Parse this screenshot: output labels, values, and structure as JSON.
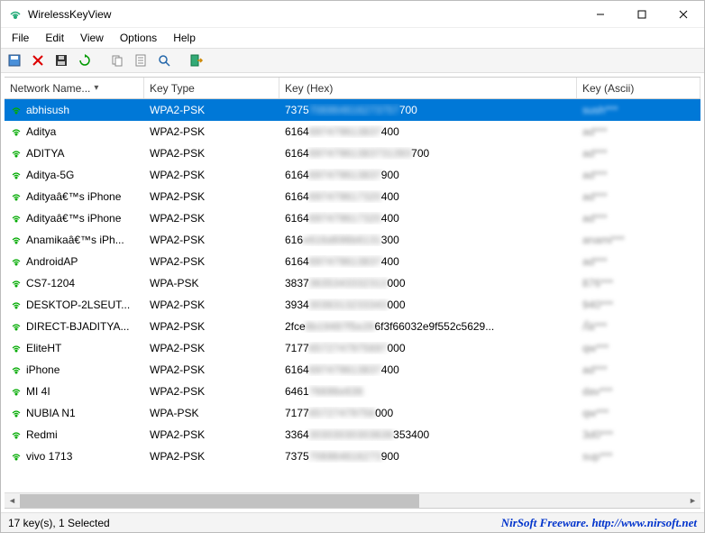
{
  "window": {
    "title": "WirelessKeyView"
  },
  "menu": {
    "items": [
      "File",
      "Edit",
      "View",
      "Options",
      "Help"
    ]
  },
  "toolbar_icons": [
    "save-icon",
    "delete-icon",
    "floppy-icon",
    "refresh-icon",
    "copy-icon",
    "properties-icon",
    "find-icon",
    "options-icon",
    "exit-icon"
  ],
  "columns": {
    "name": "Network Name...",
    "type": "Key Type",
    "hex": "Key (Hex)",
    "ascii": "Key (Ascii)"
  },
  "rows": [
    {
      "name": "abhisush",
      "type": "WPA2-PSK",
      "hex": "7375",
      "hex_tail": "706964616273757",
      "hex_end": "700",
      "ascii": "sush***",
      "selected": true
    },
    {
      "name": "Aditya",
      "type": "WPA2-PSK",
      "hex": "6164",
      "hex_tail": "697479613837",
      "hex_end": "400",
      "ascii": "ad***"
    },
    {
      "name": "ADITYA",
      "type": "WPA2-PSK",
      "hex": "6164",
      "hex_tail": "69747961383731393",
      "hex_end": "700",
      "ascii": "ad***"
    },
    {
      "name": "Aditya-5G",
      "type": "WPA2-PSK",
      "hex": "6164",
      "hex_tail": "697479613837",
      "hex_end": "900",
      "ascii": "ad***"
    },
    {
      "name": "Adityaâ€™s iPhone",
      "type": "WPA2-PSK",
      "hex": "6164",
      "hex_tail": "697479617320",
      "hex_end": "400",
      "ascii": "ad***"
    },
    {
      "name": "Adityaâ€™s iPhone",
      "type": "WPA2-PSK",
      "hex": "6164",
      "hex_tail": "697479617320",
      "hex_end": "400",
      "ascii": "ad***"
    },
    {
      "name": "Anamikaâ€™s iPh...",
      "type": "WPA2-PSK",
      "hex": "616",
      "hex_tail": "e616d696b6131",
      "hex_end": "300",
      "ascii": "anami***"
    },
    {
      "name": "AndroidAP",
      "type": "WPA2-PSK",
      "hex": "6164",
      "hex_tail": "697479613837",
      "hex_end": "400",
      "ascii": "ad***"
    },
    {
      "name": "CS7-1204",
      "type": "WPA-PSK",
      "hex": "3837",
      "hex_tail": "3635343332313",
      "hex_end": "000",
      "ascii": "876***"
    },
    {
      "name": "DESKTOP-2LSEUT...",
      "type": "WPA2-PSK",
      "hex": "3934",
      "hex_tail": "3036313233343",
      "hex_end": "000",
      "ascii": "940***"
    },
    {
      "name": "DIRECT-BJADITYA...",
      "type": "WPA2-PSK",
      "hex": "2fce",
      "hex_tail": "8b19487f5e26",
      "hex_end": "6f3f66032e9f552c5629...",
      "ascii": "/Îä***"
    },
    {
      "name": "EliteHT",
      "type": "WPA2-PSK",
      "hex": "7177",
      "hex_tail": "6572747975697",
      "hex_end": "000",
      "ascii": "qw***"
    },
    {
      "name": "iPhone",
      "type": "WPA2-PSK",
      "hex": "6164",
      "hex_tail": "697479613837",
      "hex_end": "400",
      "ascii": "ad***"
    },
    {
      "name": "MI 4I",
      "type": "WPA2-PSK",
      "hex": "6461",
      "hex_tail": "76696e636",
      "hex_end": "",
      "ascii": "dav***"
    },
    {
      "name": "NUBIA N1",
      "type": "WPA-PSK",
      "hex": "7177",
      "hex_tail": "65727479756",
      "hex_end": "000",
      "ascii": "qw***"
    },
    {
      "name": "Redmi",
      "type": "WPA2-PSK",
      "hex": "3364",
      "hex_tail": "30303030303636",
      "hex_end": "353400",
      "ascii": "3d0***"
    },
    {
      "name": "vivo 1713",
      "type": "WPA2-PSK",
      "hex": "7375",
      "hex_tail": "706964616273",
      "hex_end": "900",
      "ascii": "sup***"
    }
  ],
  "status": {
    "left": "17 key(s), 1 Selected",
    "right": "NirSoft Freeware.  http://www.nirsoft.net"
  }
}
